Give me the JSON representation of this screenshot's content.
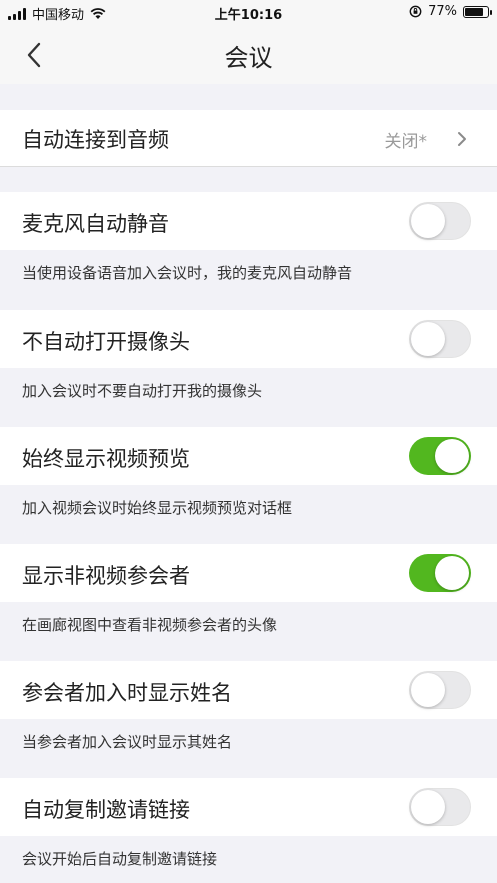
{
  "status_bar": {
    "carrier": "中国移动",
    "time": "上午10:16",
    "battery": "77%"
  },
  "nav": {
    "title": "会议"
  },
  "auto_connect": {
    "label": "自动连接到音频",
    "value": "关闭*"
  },
  "settings": [
    {
      "label": "麦克风自动静音",
      "enabled": false,
      "description": "当使用设备语音加入会议时，我的麦克风自动静音"
    },
    {
      "label": "不自动打开摄像头",
      "enabled": false,
      "description": "加入会议时不要自动打开我的摄像头"
    },
    {
      "label": "始终显示视频预览",
      "enabled": true,
      "description": "加入视频会议时始终显示视频预览对话框"
    },
    {
      "label": "显示非视频参会者",
      "enabled": true,
      "description": "在画廊视图中查看非视频参会者的头像"
    },
    {
      "label": "参会者加入时显示姓名",
      "enabled": false,
      "description": "当参会者加入会议时显示其姓名"
    },
    {
      "label": "自动复制邀请链接",
      "enabled": false,
      "description": "会议开始后自动复制邀请链接"
    }
  ],
  "colors": {
    "toggle_on": "#52b71f",
    "toggle_off": "#e9e9eb"
  }
}
